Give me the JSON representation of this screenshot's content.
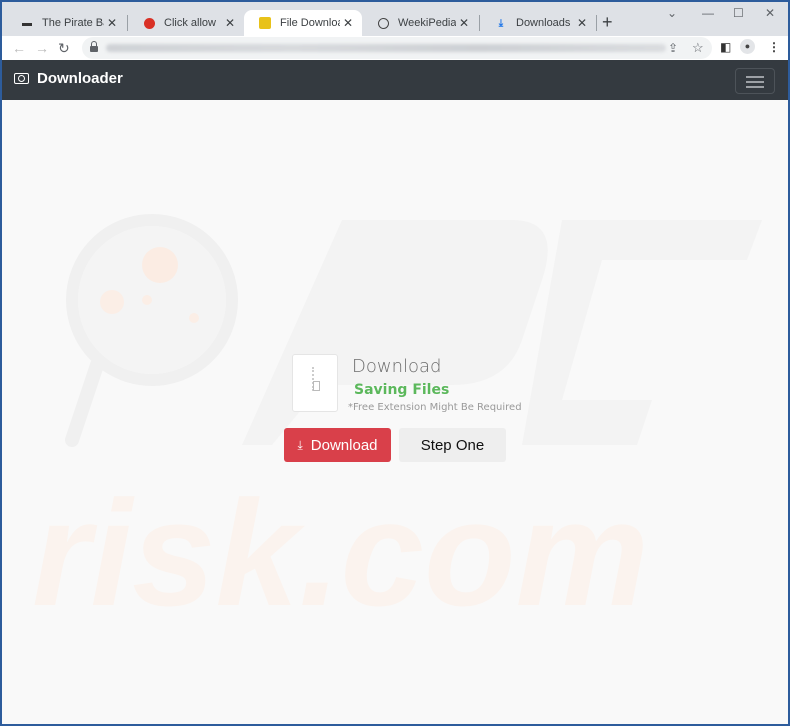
{
  "browser": {
    "tabs": [
      {
        "title": "The Pirate Bay - Th",
        "icon": "pirate-ship-icon",
        "active": false
      },
      {
        "title": "Click allow",
        "icon": "red-circle-icon",
        "active": false
      },
      {
        "title": "File Download",
        "icon": "lock-icon",
        "active": true
      },
      {
        "title": "WeekiPedia. Wiki f",
        "icon": "wordpress-icon",
        "active": false
      },
      {
        "title": "Downloads",
        "icon": "download-icon",
        "active": false
      }
    ],
    "close_glyph": "✕",
    "new_tab_glyph": "+",
    "window_controls": {
      "tab_search": "⌄",
      "minimize": "—",
      "maximize": "☐",
      "close": "✕"
    },
    "nav": {
      "back": "←",
      "forward": "→",
      "reload": "↻"
    },
    "toolbar_icons": {
      "share": "⇪",
      "star": "☆",
      "sidepanel": "◧",
      "profile": "●",
      "menu": "⋮"
    }
  },
  "page": {
    "brand": "Downloader",
    "heading": "Download",
    "status": "Saving Files",
    "note": "*Free Extension Might Be Required",
    "download_button": "Download",
    "download_glyph": "⤓",
    "step_button": "Step One",
    "colors": {
      "navbar": "#343a40",
      "status_green": "#5cb85c",
      "download_red": "#d9404a"
    }
  },
  "watermark": {
    "text": "risk.com",
    "logo": "PC"
  }
}
